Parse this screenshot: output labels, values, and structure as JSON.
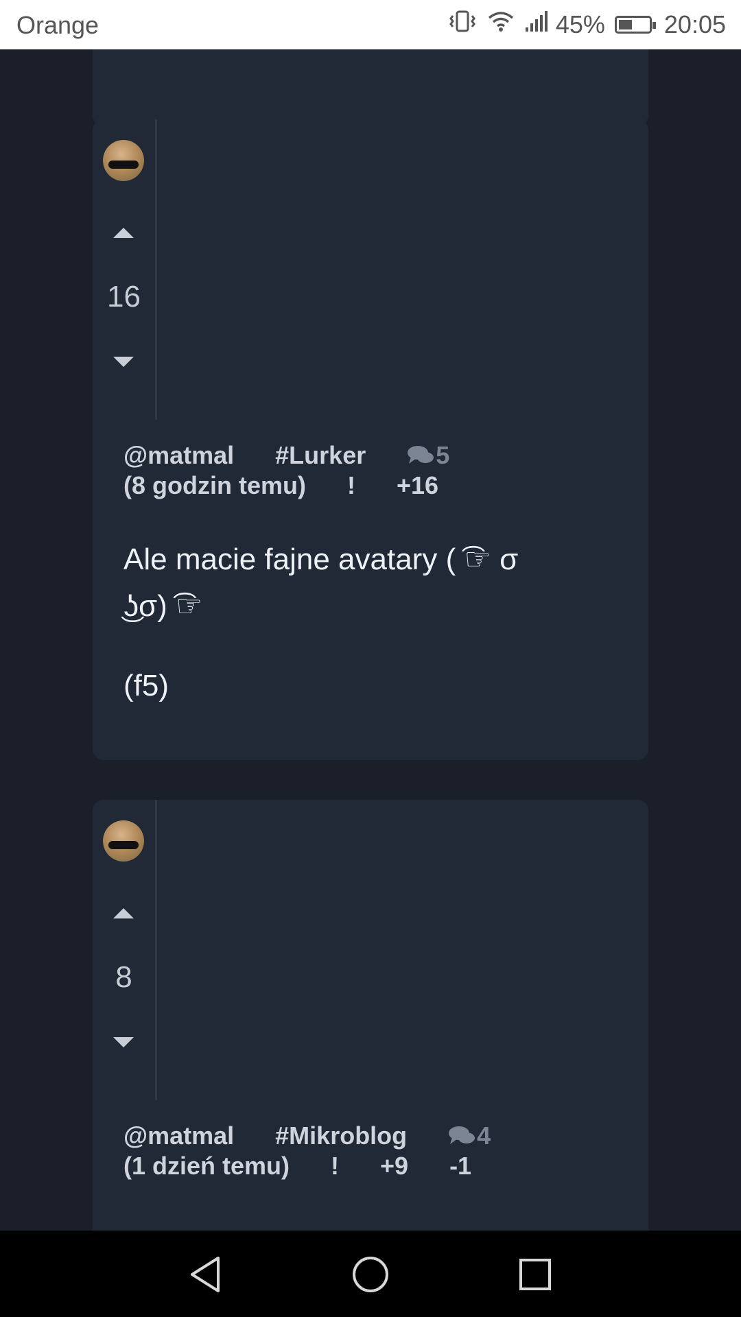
{
  "status_bar": {
    "carrier": "Orange",
    "battery_percent": "45%",
    "battery_level": 0.45,
    "time": "20:05",
    "icons": [
      "vibrate-icon",
      "wifi-icon",
      "signal-icon",
      "battery-icon"
    ]
  },
  "posts": [
    {
      "votes": "16",
      "author": "@matmal",
      "tag": "#Lurker",
      "comments": "5",
      "time": "(8 godzin temu)",
      "flag": "!",
      "plus": "+16",
      "minus": "",
      "body_line1": "Ale macie fajne avatary ( ͡☞ σ",
      "body_line2": "͜ʖσ) ͡☞",
      "body_line3": "(f5)"
    },
    {
      "votes": "8",
      "author": "@matmal",
      "tag": "#Mikroblog",
      "comments": "4",
      "time": "(1 dzień temu)",
      "flag": "!",
      "plus": "+9",
      "minus": "-1"
    }
  ],
  "colors": {
    "background": "#1b1f29",
    "card": "#212936",
    "text": "#eef1f5",
    "meta": "#cfd4dc",
    "muted": "#7c8594"
  }
}
